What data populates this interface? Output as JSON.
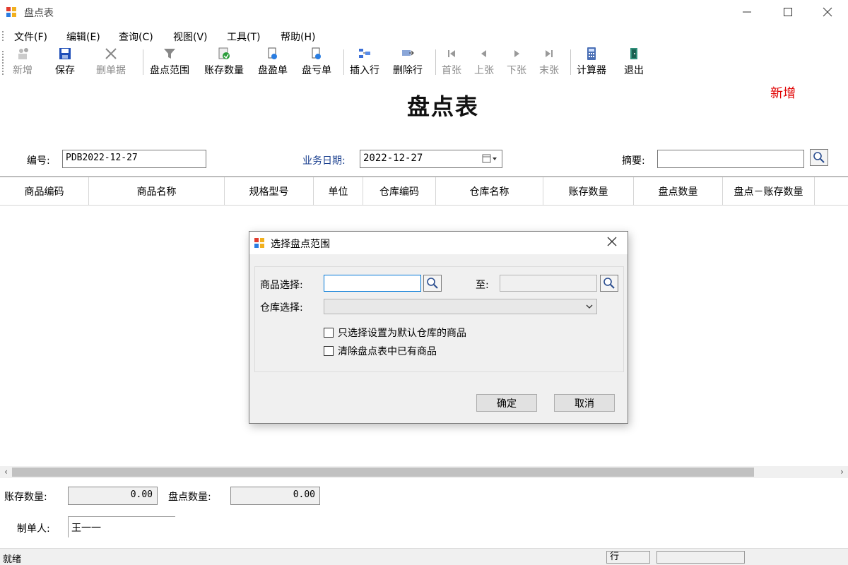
{
  "window": {
    "title": "盘点表"
  },
  "menu": [
    "文件(F)",
    "编辑(E)",
    "查询(C)",
    "视图(V)",
    "工具(T)",
    "帮助(H)"
  ],
  "toolbar": {
    "new": "新增",
    "save": "保存",
    "delete": "删单据",
    "range": "盘点范围",
    "book_qty": "账存数量",
    "surplus": "盘盈单",
    "loss": "盘亏单",
    "insert_row": "插入行",
    "delete_row": "删除行",
    "first": "首张",
    "prev": "上张",
    "next": "下张",
    "last": "末张",
    "calculator": "计算器",
    "exit": "退出"
  },
  "form": {
    "title": "盘点表",
    "status": "新增",
    "number_label": "编号:",
    "number_value": "PDB2022-12-27",
    "date_label": "业务日期:",
    "date_value": "2022-12-27",
    "summary_label": "摘要:",
    "summary_value": ""
  },
  "grid": {
    "columns": [
      "商品编码",
      "商品名称",
      "规格型号",
      "单位",
      "仓库编码",
      "仓库名称",
      "账存数量",
      "盘点数量",
      "盘点－账存数量"
    ]
  },
  "footer": {
    "book_qty_label": "账存数量:",
    "book_qty_value": "0.00",
    "count_qty_label": "盘点数量:",
    "count_qty_value": "0.00",
    "creator_label": "制单人:",
    "creator_value": "王一一"
  },
  "statusbar": {
    "text": "就绪",
    "row_label": "行",
    "extra": ""
  },
  "dialog": {
    "title": "选择盘点范围",
    "goods_label": "商品选择:",
    "goods_from_value": "",
    "to_label": "至:",
    "goods_to_value": "",
    "warehouse_label": "仓库选择:",
    "warehouse_value": "",
    "check1": "只选择设置为默认仓库的商品",
    "check2": "清除盘点表中已有商品",
    "ok": "确定",
    "cancel": "取消"
  },
  "colors": {
    "status_red": "#e00000",
    "focus_blue": "#0078d7"
  }
}
